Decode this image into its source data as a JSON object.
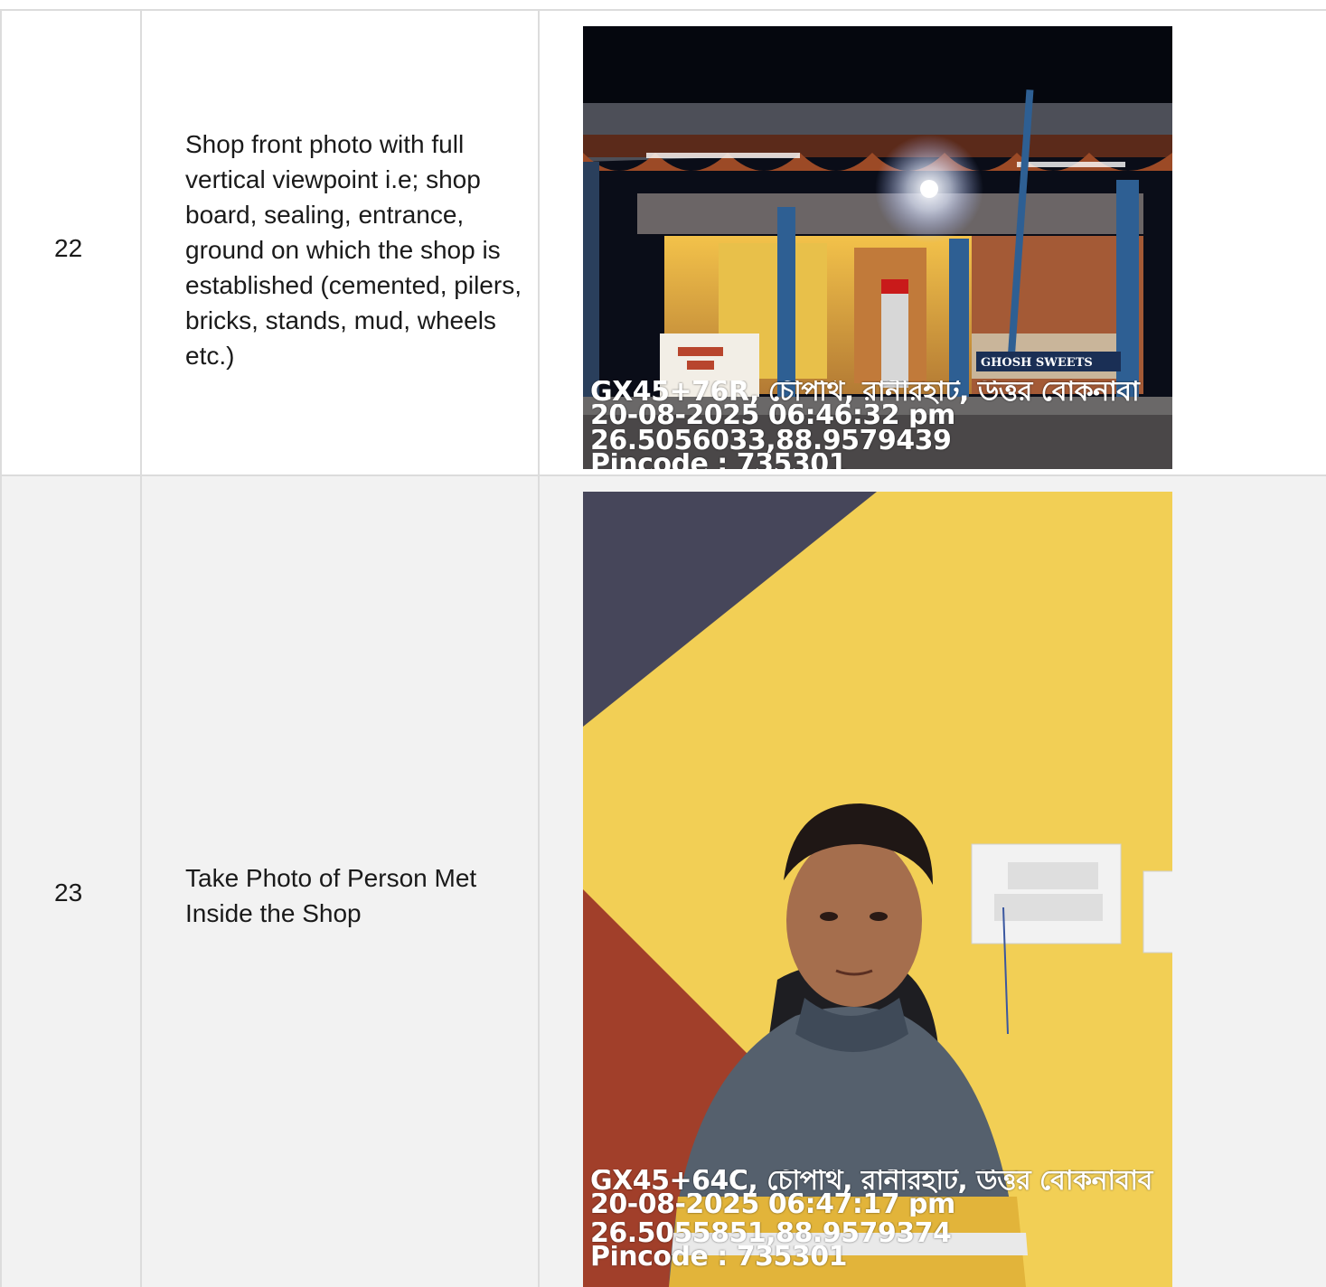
{
  "rows": [
    {
      "number": "22",
      "description": "Shop front photo with full vertical viewpoint i.e; shop board, sealing, entrance, ground on which the shop is established (cemented, pilers, bricks, stands, mud, wheels etc.)",
      "photo": {
        "shop_sign": "GHOSH SWEETS",
        "location": "GX45+76R, চৌপথি, রানীরহাট, উত্তর বোকনাবা",
        "datetime": "20-08-2025 06:46:32 pm",
        "coordinates": "26.5056033,88.9579439",
        "pincode": "Pincode : 735301"
      }
    },
    {
      "number": "23",
      "description": "Take Photo of Person Met Inside the Shop",
      "photo": {
        "location": "GX45+64C, চৌপথি, রানীরহাট, উত্তর বোকনাবাব",
        "datetime": "20-08-2025 06:47:17 pm",
        "coordinates": "26.5055851,88.9579374",
        "pincode": "Pincode : 735301"
      }
    }
  ]
}
